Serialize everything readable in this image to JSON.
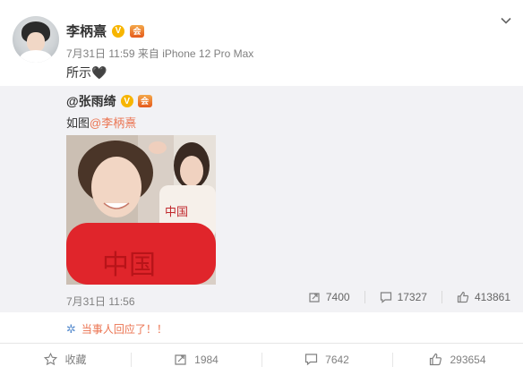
{
  "post": {
    "author": "李柄熹",
    "vip_badge": "V",
    "level_badge": "🏅",
    "time": "7月31日 11:59",
    "source_prefix": "来自",
    "source": "iPhone 12 Pro Max",
    "text": "所示🖤"
  },
  "repost": {
    "author": "@张雨绮",
    "vip_badge": "V",
    "text_prefix": "如图",
    "mention": "@李柄熹",
    "date": "7月31日 11:56",
    "reposts": "7400",
    "comments": "17327",
    "likes": "413861",
    "photo_text": "中国"
  },
  "comment_preview": "当事人回应了！！",
  "actions": {
    "favorite_label": "收藏",
    "repost_count": "1984",
    "comment_count": "7642",
    "like_count": "293654"
  },
  "colors": {
    "link": "#eb7350",
    "repost_bg": "#f2f2f5",
    "muted": "#808080"
  }
}
